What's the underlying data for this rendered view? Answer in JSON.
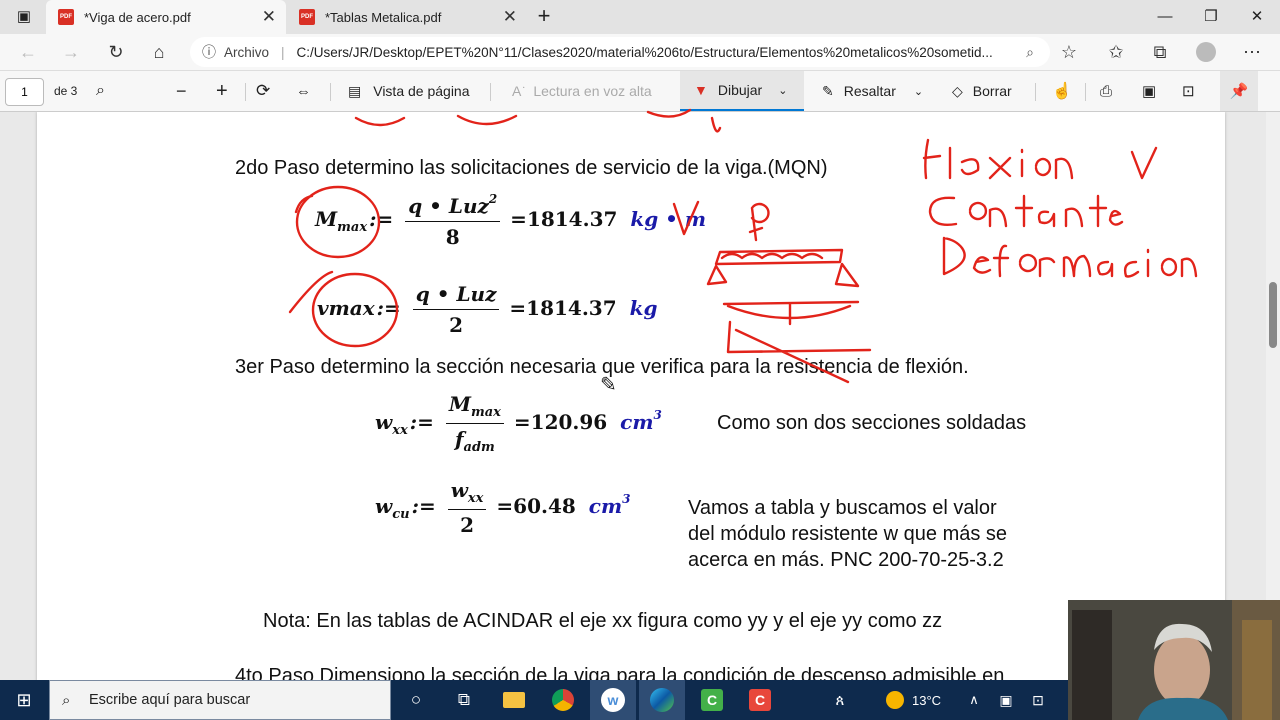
{
  "tabs": [
    {
      "title": "*Viga de acero.pdf",
      "icon": "pdf-icon"
    },
    {
      "title": "*Tablas Metalica.pdf",
      "icon": "pdf-icon"
    }
  ],
  "address": {
    "site_label": "Archivo",
    "url": "C:/Users/JR/Desktop/EPET%20N°11/Clases2020/material%206to/Estructura/Elementos%20metalicos%20sometid..."
  },
  "pdf_toolbar": {
    "page": "1",
    "page_of": "de 3",
    "page_view": "Vista de página",
    "read_aloud": "Lectura en voz alta",
    "draw": "Dibujar",
    "highlight": "Resaltar",
    "erase": "Borrar"
  },
  "document": {
    "step2": "2do Paso determino las solicitaciones de servicio de la viga.(MQN)",
    "mmax_formula": {
      "lhs": "M",
      "lhs_sub": "max",
      "assign": ":=",
      "num_a": "q • Luz",
      "num_sup": "2",
      "den": "8",
      "eq": "=",
      "value": "1814.37",
      "unit": "kg • m"
    },
    "vmax_formula": {
      "lhs": "vmax",
      "assign": ":=",
      "num": "q • Luz",
      "den": "2",
      "eq": "=",
      "value": "1814.37",
      "unit": "kg"
    },
    "step3": "3er Paso determino la sección necesaria que verifica para la resistencia de flexión.",
    "wxx_formula": {
      "lhs": "w",
      "lhs_sub": "xx",
      "assign": ":=",
      "num": "M",
      "num_sub": "max",
      "den": "f",
      "den_sub": "adm",
      "eq": "=",
      "value": "120.96",
      "unit": "cm",
      "unit_sup": "3"
    },
    "note_two_sections": "Como son dos secciones soldadas",
    "wcu_formula": {
      "lhs": "w",
      "lhs_sub": "cu",
      "assign": ":=",
      "num": "w",
      "num_sub": "xx",
      "den": "2",
      "eq": "=",
      "value": "60.48",
      "unit": "cm",
      "unit_sup": "3"
    },
    "table_lines": [
      "Vamos a tabla y buscamos el valor",
      "del módulo resistente w que más se",
      "acerca en más. PNC 200-70-25-3.2"
    ],
    "acindar_note": "Nota: En las tablas de ACINDAR el eje xx figura como yy y el eje yy como zz",
    "step4": "4to Paso Dimensiono la sección de la viga para la condición de descenso admisible en"
  },
  "handwriting": {
    "lines": [
      "flexion V",
      "Contante",
      "Deformacion"
    ],
    "v": "V",
    "q": "q"
  },
  "taskbar": {
    "search_placeholder": "Escribe aquí para buscar",
    "temperature": "13°C"
  },
  "colors": {
    "ink": "#e2231a",
    "accent": "#0078d4",
    "taskbar": "#0e2a4d"
  }
}
